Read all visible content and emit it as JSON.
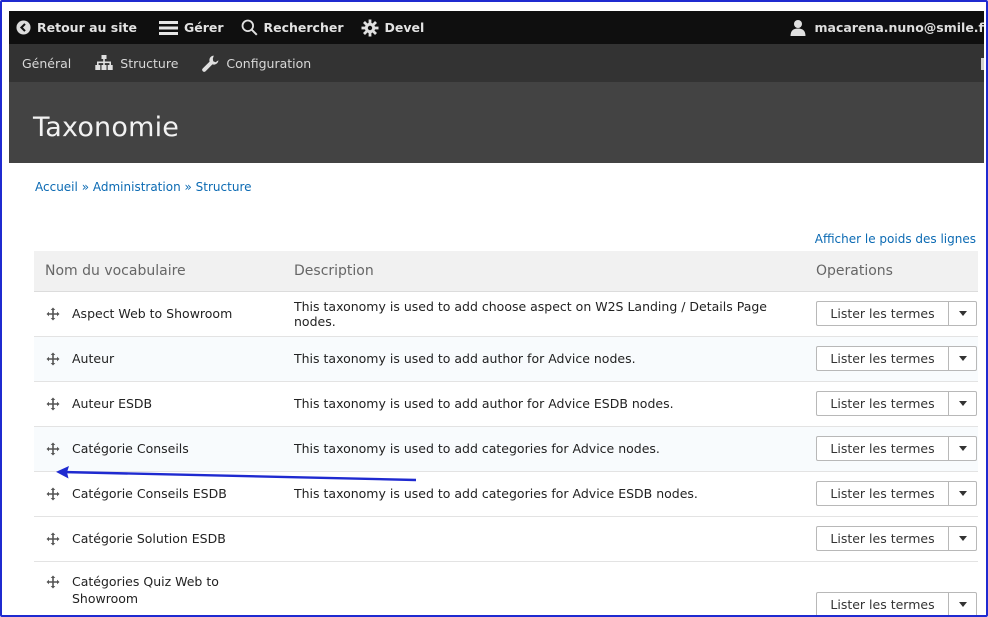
{
  "toolbar": {
    "back_label": "Retour au site",
    "manage_label": "Gérer",
    "search_label": "Rechercher",
    "devel_label": "Devel",
    "user_label": "macarena.nuno@smile.f"
  },
  "subbar": {
    "general_label": "Général",
    "structure_label": "Structure",
    "config_label": "Configuration"
  },
  "page": {
    "title": "Taxonomie"
  },
  "breadcrumb": {
    "home": "Accueil",
    "admin": "Administration",
    "structure": "Structure",
    "separator": "»"
  },
  "table": {
    "show_weights_label": "Afficher le poids des lignes",
    "headers": {
      "name": "Nom du vocabulaire",
      "description": "Description",
      "operations": "Operations"
    },
    "op_button_label": "Lister les termes",
    "rows": [
      {
        "name": "Aspect Web to Showroom",
        "description": "This taxonomy is used to add choose aspect on W2S Landing / Details Page nodes."
      },
      {
        "name": "Auteur",
        "description": "This taxonomy is used to add author for Advice nodes."
      },
      {
        "name": "Auteur ESDB",
        "description": "This taxonomy is used to add author for Advice ESDB nodes."
      },
      {
        "name": "Catégorie Conseils",
        "description": "This taxonomy is used to add categories for Advice nodes."
      },
      {
        "name": "Catégorie Conseils ESDB",
        "description": "This taxonomy is used to add categories for Advice ESDB nodes."
      },
      {
        "name": "Catégorie Solution ESDB",
        "description": ""
      },
      {
        "name": "Catégories Quiz Web to Showroom",
        "description": ""
      }
    ]
  },
  "colors": {
    "frame_border": "#1f2ad0",
    "annotation_arrow": "#1f2ad0",
    "link": "#0b6ab3",
    "toolbar_bg": "#0f0f0f",
    "subbar_bg": "#333333",
    "header_bg": "#434343"
  },
  "icons": {
    "back": "back-circle-icon",
    "manage": "hamburger-icon",
    "search": "search-icon",
    "devel": "gear-icon",
    "user": "user-icon",
    "structure": "sitemap-icon",
    "config": "wrench-icon",
    "drag": "drag-handle-icon",
    "dropdown": "caret-down-icon"
  }
}
